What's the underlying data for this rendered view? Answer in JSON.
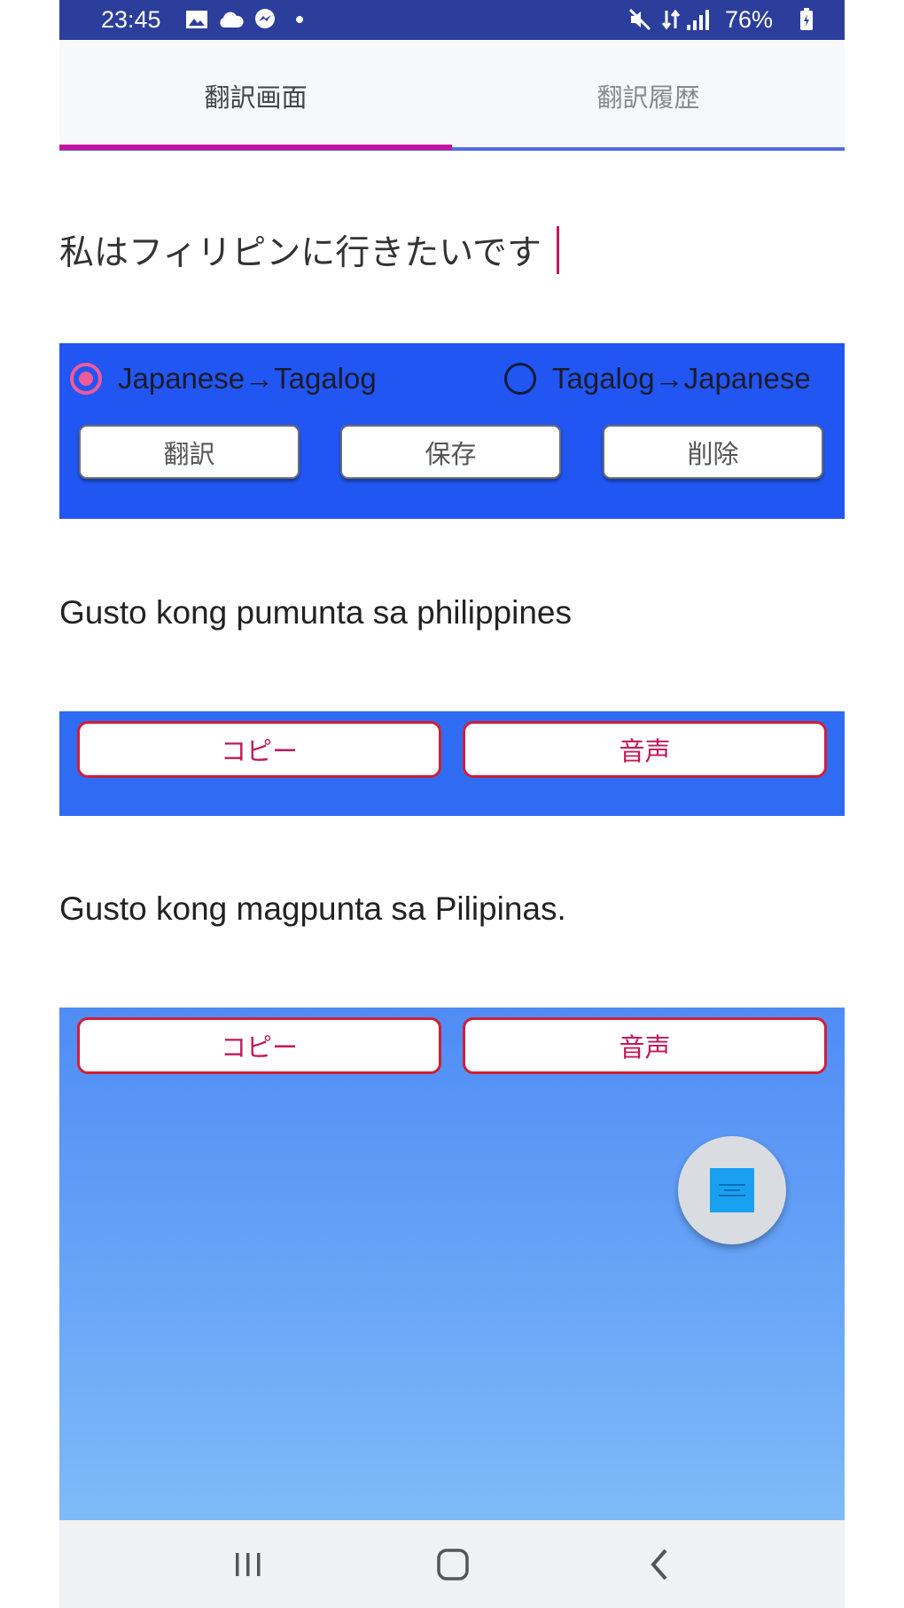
{
  "status_bar": {
    "time": "23:45",
    "battery_percent": "76%",
    "icons": [
      "gallery-icon",
      "cloud-icon",
      "messenger-icon",
      "dot-icon",
      "mute-icon",
      "data-icon",
      "signal-icon",
      "battery-icon"
    ]
  },
  "tabs": [
    {
      "label": "翻訳画面",
      "active": true
    },
    {
      "label": "翻訳履歴",
      "active": false
    }
  ],
  "input": {
    "value": "私はフィリピンに行きたいです"
  },
  "direction": {
    "option1": "Japanese→Tagalog",
    "option2": "Tagalog→Japanese",
    "selected": "Japanese→Tagalog"
  },
  "actions": {
    "translate": "翻訳",
    "save": "保存",
    "delete": "削除"
  },
  "result1": {
    "text": "Gusto kong pumunta sa philippines",
    "copy": "コピー",
    "speak": "音声"
  },
  "result2": {
    "text": "Gusto kong magpunta sa Pilipinas.",
    "copy": "コピー",
    "speak": "音声"
  },
  "fab": {
    "icon": "app-icon"
  },
  "nav": {
    "icons": [
      "recent-apps-icon",
      "home-icon",
      "back-icon"
    ]
  },
  "colors": {
    "status_bar": "#2c3e9c",
    "panel_blue": "#2156f2",
    "tab_indicator": "#c4149e",
    "radio_selected": "#f05a9b",
    "button_border_red": "#d21d36",
    "button_text_red": "#c2185b"
  }
}
